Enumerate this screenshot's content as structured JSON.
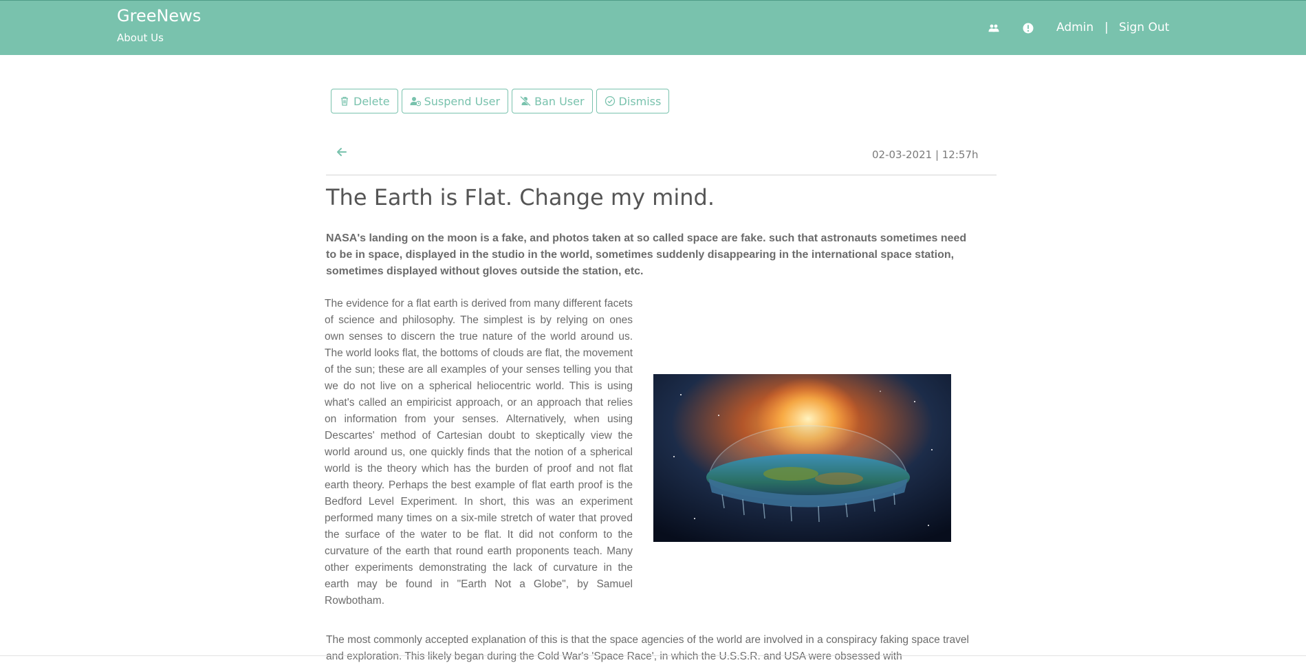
{
  "header": {
    "brand": "GreeNews",
    "about_link": "About Us",
    "icons": [
      "users-icon",
      "info-icon"
    ],
    "admin_link": "Admin",
    "separator": "|",
    "signout_link": "Sign Out"
  },
  "actions": {
    "delete": "Delete",
    "suspend": "Suspend User",
    "ban": "Ban User",
    "dismiss": "Dismiss"
  },
  "article": {
    "date": "02-03-2021 | 12:57h",
    "title": "The Earth is Flat. Change my mind.",
    "lead": "NASA's landing on the moon is a fake, and photos taken at so called space are fake. such that astronauts sometimes need to be in space, displayed in the studio in the world, sometimes suddenly disappearing in the international space station, sometimes displayed without gloves outside the station, etc.",
    "body": "The evidence for a flat earth is derived from many different facets of science and philosophy. The simplest is by relying on ones own senses to discern the true nature of the world around us. The world looks flat, the bottoms of clouds are flat, the movement of the sun; these are all examples of your senses telling you that we do not live on a spherical heliocentric world. This is using what's called an empiricist approach, or an approach that relies on information from your senses. Alternatively, when using Descartes' method of Cartesian doubt to skeptically view the world around us, one quickly finds that the notion of a spherical world is the theory which has the burden of proof and not flat earth theory. Perhaps the best example of flat earth proof is the Bedford Level Experiment. In short, this was an experiment performed many times on a six-mile stretch of water that proved the surface of the water to be flat. It did not conform to the curvature of the earth that round earth proponents teach. Many other experiments demonstrating the lack of curvature in the earth may be found in \"Earth Not a Globe\", by Samuel Rowbotham.",
    "body2": "The most commonly accepted explanation of this is that the space agencies of the world are involved in a conspiracy faking space travel and exploration. This likely began during the Cold War's 'Space Race', in which the U.S.S.R. and USA were obsessed with"
  },
  "colors": {
    "accent": "#79c2ad",
    "text": "#6b6b6b",
    "title": "#555555"
  }
}
